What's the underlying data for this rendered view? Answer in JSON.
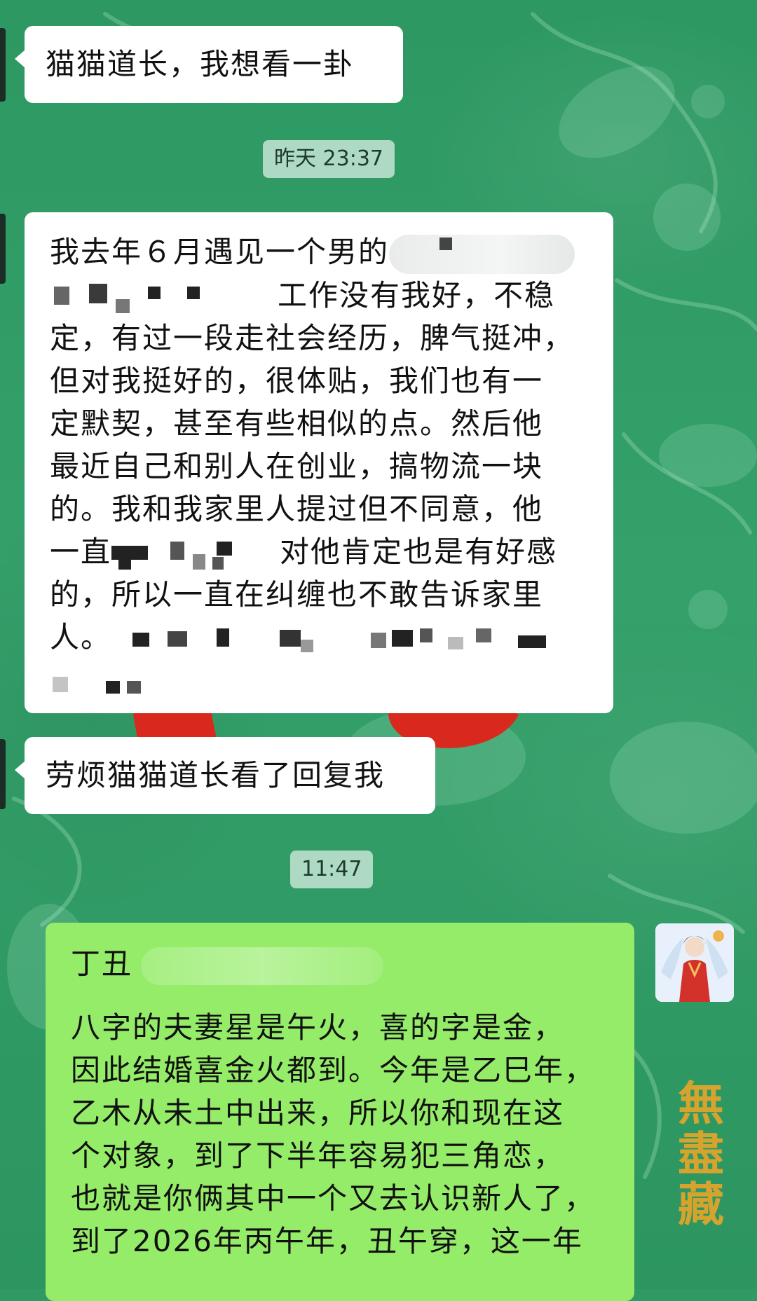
{
  "chat": {
    "messages": [
      {
        "id": "m1",
        "side": "left",
        "lines": [
          "猫猫道长，我想看一卦"
        ]
      },
      {
        "id": "t1",
        "type": "time",
        "text": "昨天 23:37"
      },
      {
        "id": "m2",
        "side": "left",
        "lines": [
          "我去年６月遇见一个男的",
          "工作没有我好，不稳",
          "定，有过一段走社会经历，脾气挺冲，",
          "但对我挺好的，很体贴，我们也有一",
          "定默契，甚至有些相似的点。然后他",
          "最近自己和别人在创业，搞物流一块",
          "的。我和我家里人提过但不同意，他",
          "一直",
          "对他肯定也是有好感",
          "的，所以一直在纠缠也不敢告诉家里",
          "人。"
        ]
      },
      {
        "id": "m3",
        "side": "left",
        "lines": [
          "劳烦猫猫道长看了回复我"
        ]
      },
      {
        "id": "t2",
        "type": "time",
        "text": "11:47"
      },
      {
        "id": "m4",
        "side": "right",
        "lines": [
          "丁丑",
          "八字的夫妻星是午火，喜的字是金，",
          "因此结婚喜金火都到。今年是乙巳年，",
          "乙木从未土中出来，所以你和现在这",
          "个对象，到了下半年容易犯三角恋，",
          "也就是你俩其中一个又去认识新人了，",
          "到了2026年丙午年，丑午穿，这一年"
        ]
      }
    ]
  },
  "watermark": {
    "seal_text": "無盡藏"
  },
  "avatar": {
    "icon": "avatar-girl-hanfu-icon"
  },
  "colors": {
    "background": "#2f9a63",
    "bubble_left": "#ffffff",
    "bubble_right": "#95ec69"
  }
}
